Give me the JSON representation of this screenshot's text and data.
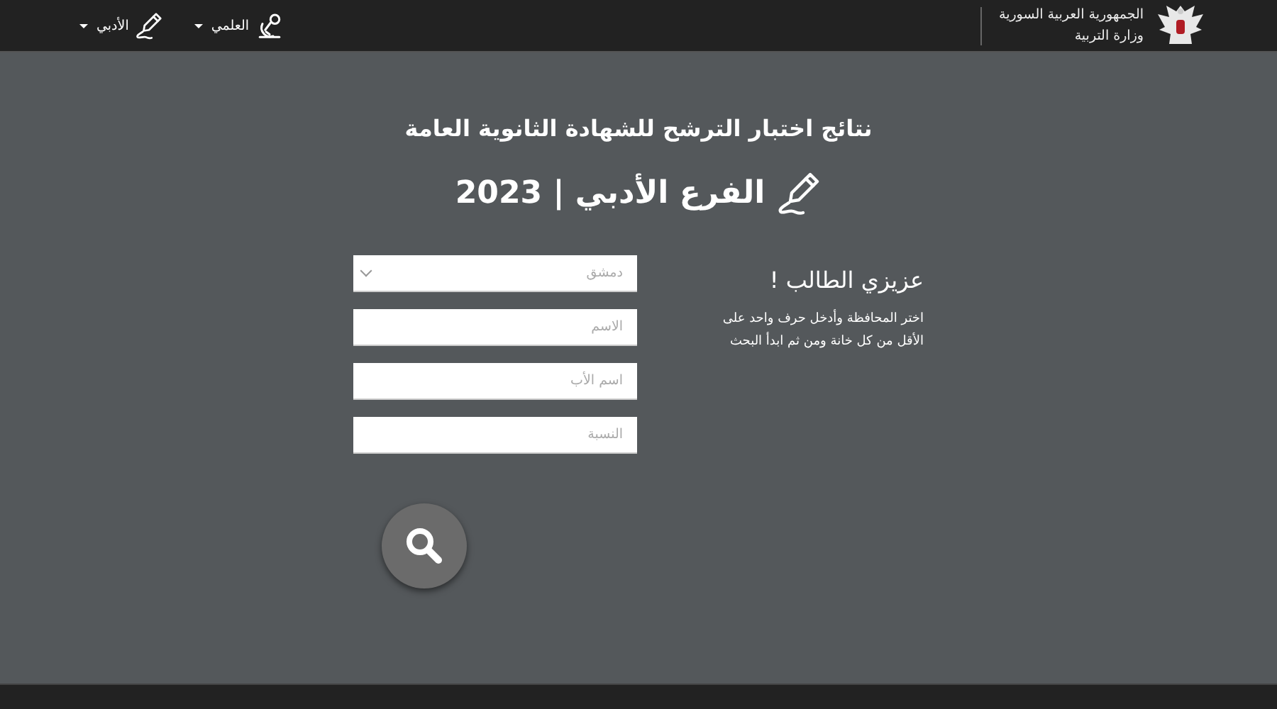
{
  "header": {
    "logo_title": "الجمهورية العربية السورية",
    "logo_subtitle": "وزارة التربية",
    "menu": [
      {
        "label": "العلمي",
        "kind": "scientific"
      },
      {
        "label": "الأدبي",
        "kind": "literary"
      }
    ]
  },
  "title": "نتائج اختبار الترشح للشهادة الثانوية العامة",
  "subtitle": "الفرع الأدبي | 2023",
  "intro": {
    "heading": "عزيزي الطالب !",
    "text": "اختر المحافظة وأدخل حرف واحد على الأقل من كل خانة ومن ثم ابدأ البحث"
  },
  "form": {
    "fields": [
      {
        "kind": "select",
        "value": "دمشق"
      },
      {
        "kind": "text",
        "placeholder": "الاسم"
      },
      {
        "kind": "text",
        "placeholder": "اسم الأب"
      },
      {
        "kind": "text",
        "placeholder": "النسبة"
      }
    ]
  }
}
